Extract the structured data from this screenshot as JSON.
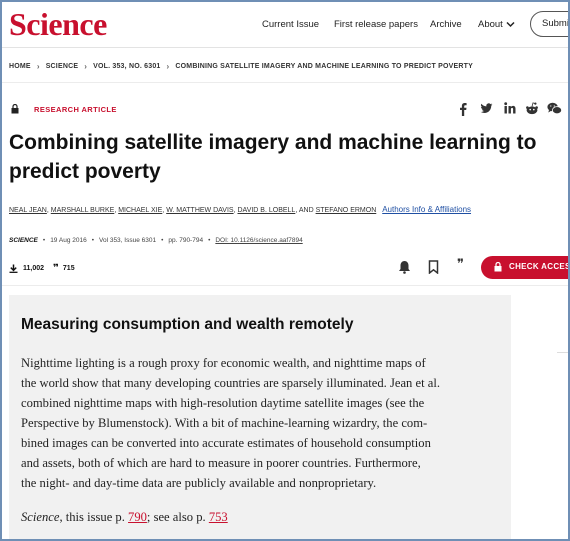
{
  "header": {
    "logo": "Science",
    "nav": [
      "Current Issue",
      "First release papers",
      "Archive",
      "About"
    ],
    "subscribe_label": "Submit"
  },
  "breadcrumb": [
    "HOME",
    "SCIENCE",
    "VOL. 353, NO. 6301",
    "COMBINING SATELLITE IMAGERY AND MACHINE LEARNING TO PREDICT POVERTY"
  ],
  "article": {
    "type": "RESEARCH ARTICLE",
    "title": "Combining satellite imagery and machine learning to predict poverty",
    "authors": [
      "NEAL JEAN",
      "MARSHALL BURKE",
      "MICHAEL XIE",
      "W. MATTHEW DAVIS",
      "DAVID B. LOBELL"
    ],
    "authors_and": "AND",
    "last_author": "STEFANO ERMON",
    "authors_info": "Authors Info & Affiliations",
    "journal": "SCIENCE",
    "date": "19 Aug 2016",
    "volume": "Vol 353, Issue 6301",
    "pages": "pp. 790-794",
    "doi": "DOI: 10.1126/science.aaf7894",
    "downloads": "11,002",
    "citations": "715",
    "check_access": "CHECK ACCESS"
  },
  "abstract": {
    "heading": "Measuring consumption and wealth remotely",
    "lines": [
      "Nighttime lighting is a rough proxy for economic wealth, and nighttime maps of",
      "the world show that many developing countries are sparsely illuminated. Jean et al.",
      "combined nighttime maps with high-resolution daytime satellite images (see the",
      "Perspective by Blumenstock). With a bit of machine-learning wizardry, the com-",
      "bined images can be converted into accurate estimates of household consumption",
      "and assets, both of which are hard to measure in poorer countries. Furthermore,",
      "the night- and day-time data are publicly available and nonproprietary."
    ],
    "cite_journal": "Science",
    "cite_text1": ", this issue p. ",
    "cite_page1": "790",
    "cite_text2": "; see also p. ",
    "cite_page2": "753"
  },
  "icons": {
    "share": [
      "facebook-icon",
      "twitter-icon",
      "linkedin-icon",
      "reddit-icon",
      "wechat-icon"
    ],
    "actions": [
      "bell-icon",
      "bookmark-icon",
      "quote-icon"
    ]
  },
  "colors": {
    "brand": "#c8102e",
    "link": "#1f4fa3",
    "abstract_bg": "#f1f1f1"
  }
}
